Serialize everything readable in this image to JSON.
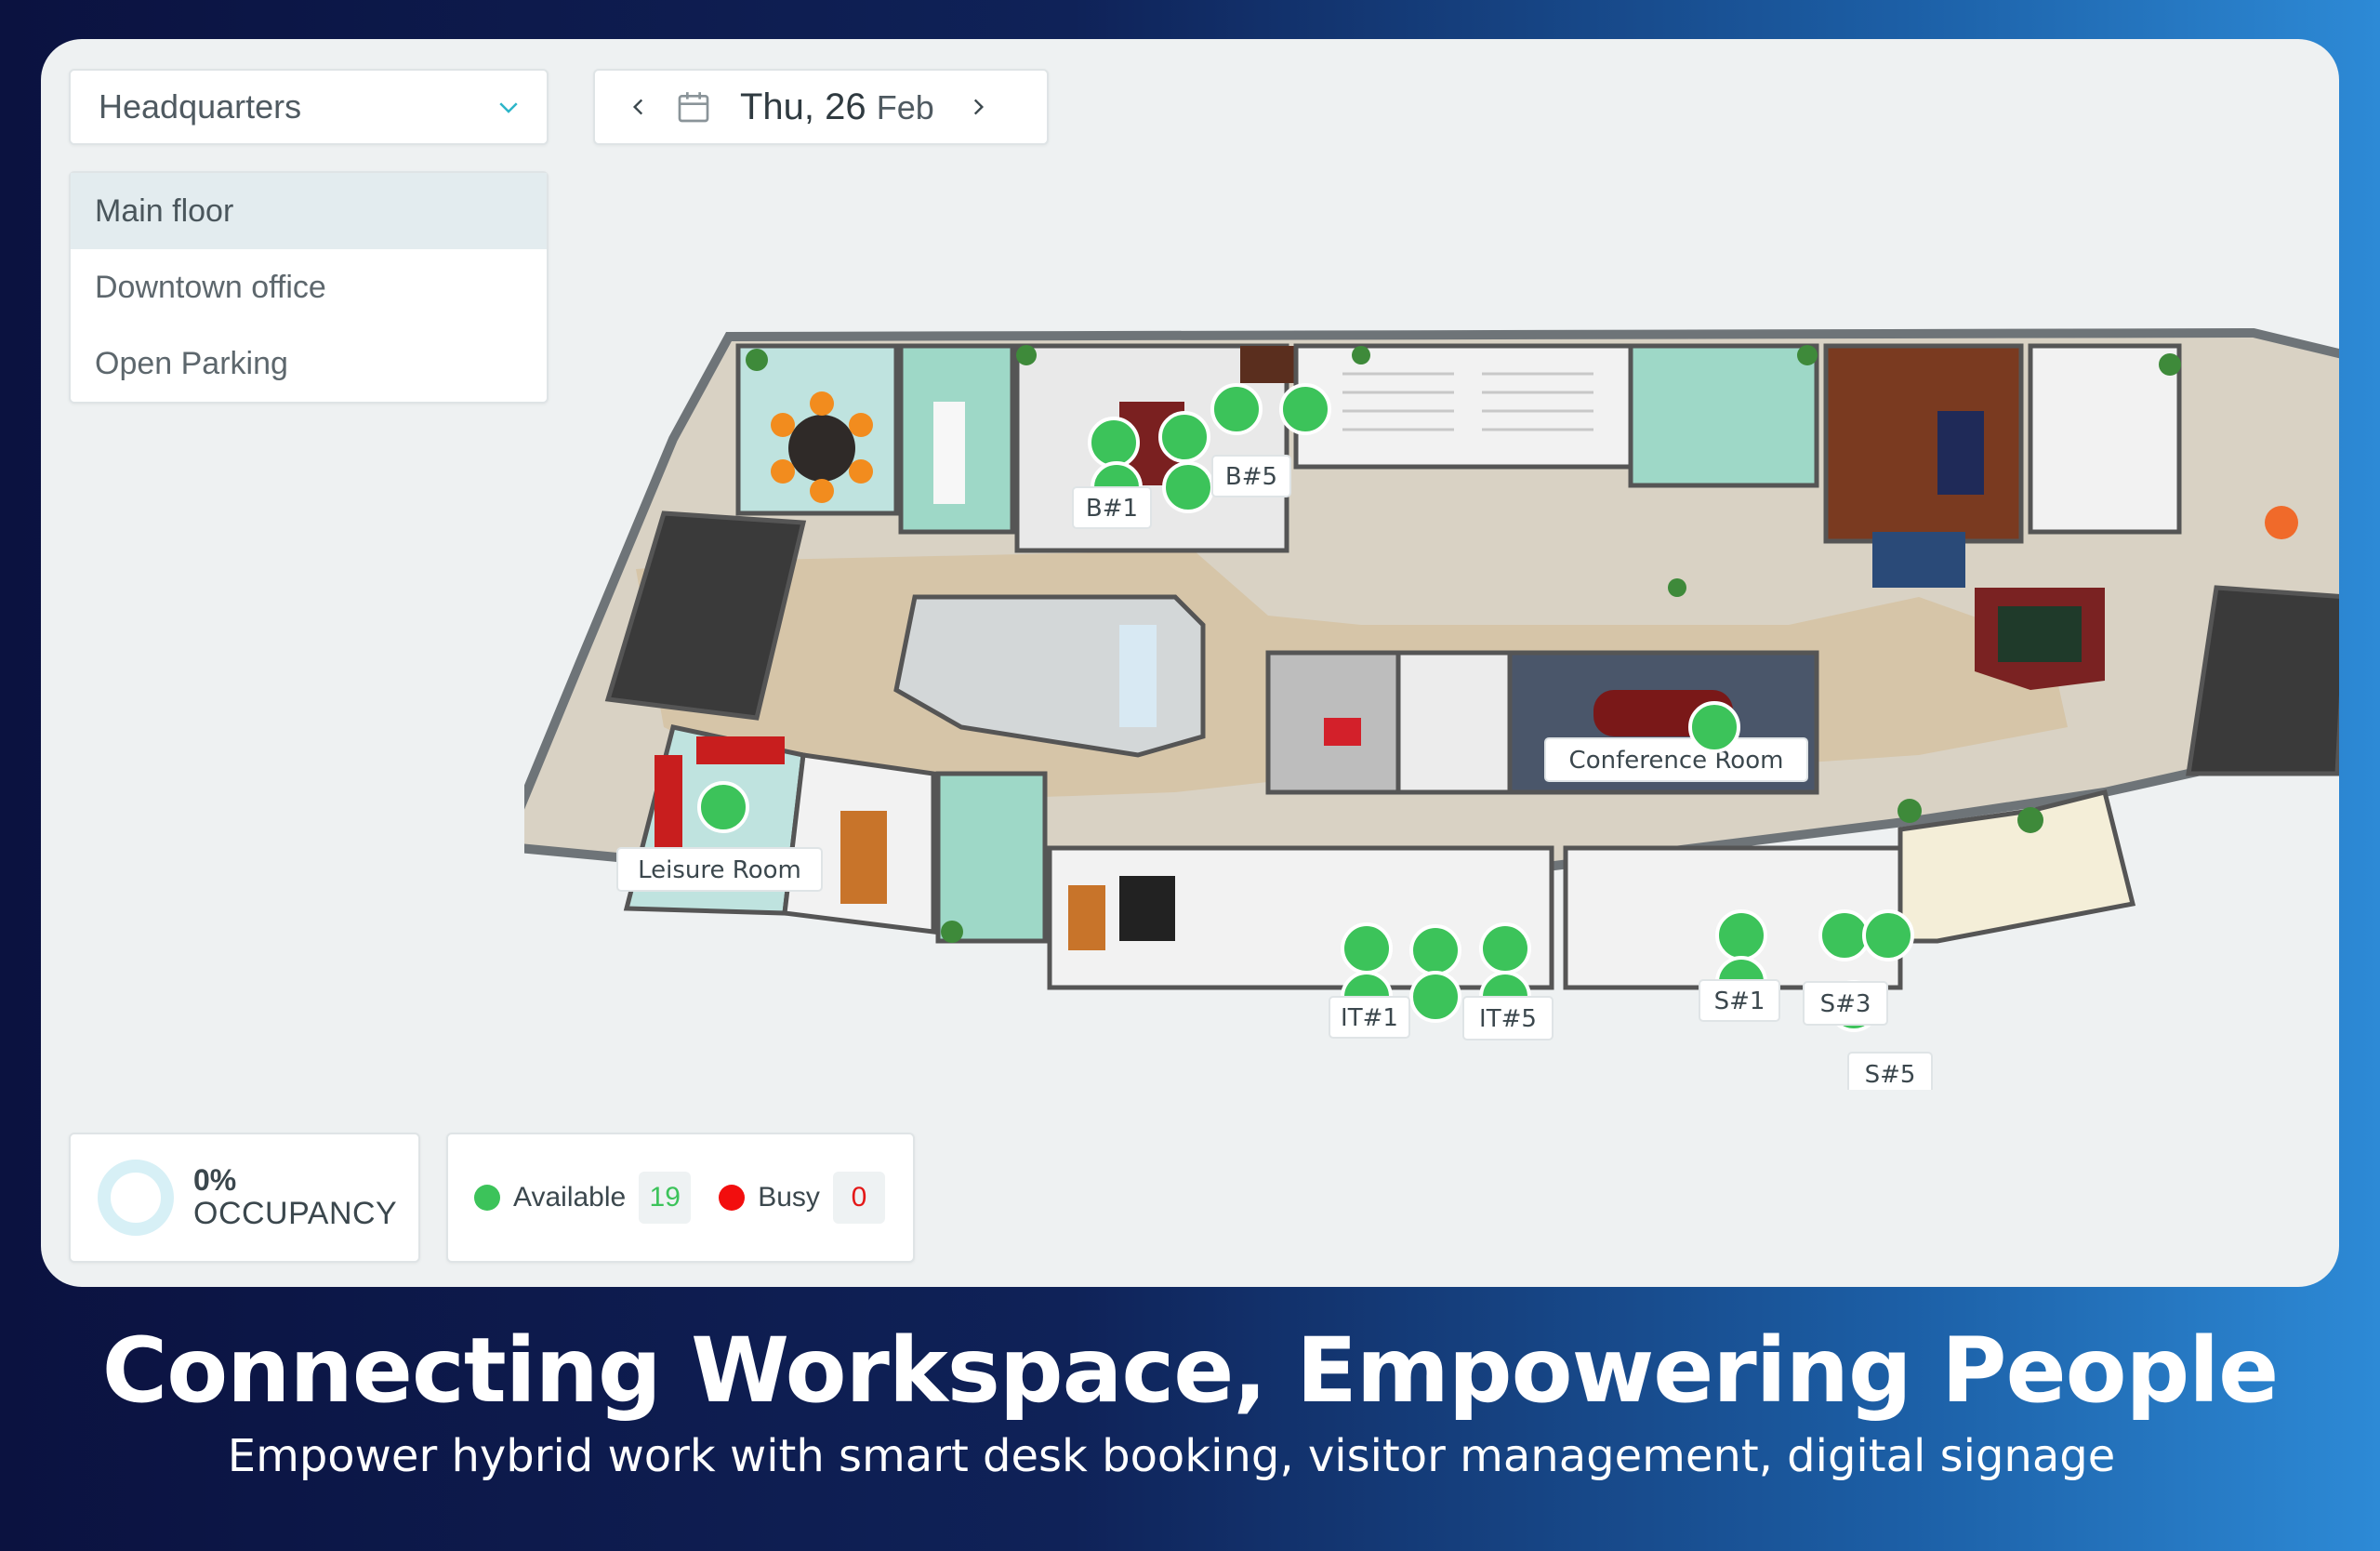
{
  "location": {
    "selected": "Headquarters"
  },
  "date": {
    "day": "Thu, 26",
    "month": "Feb"
  },
  "floors": [
    {
      "label": "Main floor",
      "active": true
    },
    {
      "label": "Downtown office",
      "active": false
    },
    {
      "label": "Open Parking",
      "active": false
    }
  ],
  "map": {
    "rooms": {
      "conference": "Conference Room",
      "leisure": "Leisure Room"
    },
    "desk_labels": {
      "b1": "B#1",
      "b5": "B#5",
      "it1": "IT#1",
      "it5": "IT#5",
      "s1": "S#1",
      "s3": "S#3",
      "s5": "S#5"
    }
  },
  "occupancy": {
    "percent": "0%",
    "label": "OCCUPANCY",
    "value": 0
  },
  "status": {
    "available_label": "Available",
    "available_count": "19",
    "busy_label": "Busy",
    "busy_count": "0"
  },
  "marketing": {
    "headline": "Connecting Workspace, Empowering People",
    "subline": "Empower hybrid work with smart desk booking, visitor management, digital signage"
  },
  "colors": {
    "available": "#3cc35a",
    "busy": "#f20e0e",
    "card_bg": "#eef1f2"
  },
  "icons": [
    "chevron-down-icon",
    "chevron-left-icon",
    "calendar-icon",
    "chevron-right-icon"
  ]
}
